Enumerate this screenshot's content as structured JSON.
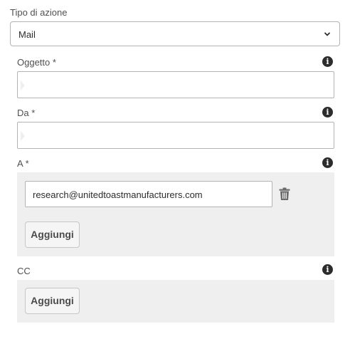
{
  "action_type": {
    "label": "Tipo di azione",
    "value": "Mail"
  },
  "fields": {
    "subject": {
      "label": "Oggetto *",
      "value": ""
    },
    "from": {
      "label": "Da *",
      "value": ""
    },
    "to": {
      "label": "A *",
      "recipients": [
        "research@unitedtoastmanufacturers.com"
      ],
      "add_label": "Aggiungi"
    },
    "cc": {
      "label": "CC",
      "add_label": "Aggiungi"
    }
  },
  "icons": {
    "info": "info-icon",
    "delete": "trash-icon",
    "dropdown": "chevron-down-icon"
  },
  "info_glyph": "i"
}
